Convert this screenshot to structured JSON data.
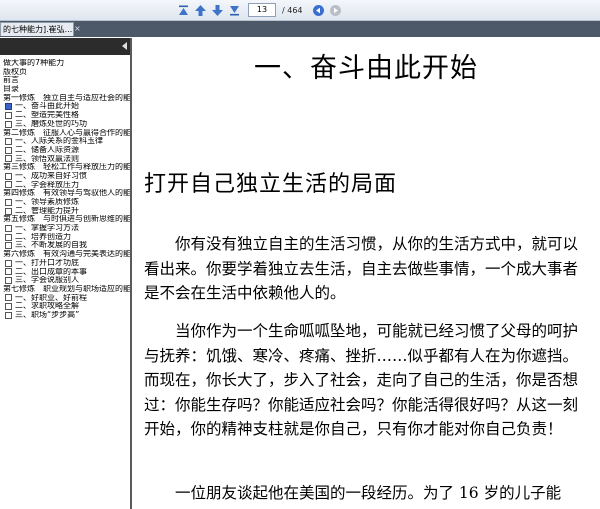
{
  "toolbar": {
    "page_current": "13",
    "page_total": "/ 464",
    "icons": [
      "first-page-icon",
      "previous-page-icon",
      "next-page-icon",
      "last-page-icon",
      "go-back-icon",
      "go-forward-icon"
    ]
  },
  "tab": {
    "title": "的七种能力].崔弘....",
    "close": "×"
  },
  "sidebar": {
    "items": [
      {
        "label": "做大事的7种能力",
        "box": false
      },
      {
        "label": "版权页",
        "box": false
      },
      {
        "label": "前言",
        "box": false
      },
      {
        "label": "目录",
        "box": false
      },
      {
        "label": "第一修炼　独立自主与适应社会的能",
        "box": false
      },
      {
        "label": "一、奋斗由此开始",
        "box": true,
        "selected": true
      },
      {
        "label": "二、塑造完美性格",
        "box": true
      },
      {
        "label": "三、磨炼处世的巧功",
        "box": true
      },
      {
        "label": "第二修炼　征服人心与赢得合作的能",
        "box": false
      },
      {
        "label": "一、人际关系的金科玉律",
        "box": true
      },
      {
        "label": "二、储备人际资源",
        "box": true
      },
      {
        "label": "三、领悟双赢法则",
        "box": true
      },
      {
        "label": "第三修炼　轻松工作与释放压力的能",
        "box": false
      },
      {
        "label": "一、成功来自好习惯",
        "box": true
      },
      {
        "label": "二、学会释放压力",
        "box": true
      },
      {
        "label": "第四修炼　有效领导与驾驭他人的能",
        "box": false
      },
      {
        "label": "一、领导素质修炼",
        "box": true
      },
      {
        "label": "二、管理能力提升",
        "box": true
      },
      {
        "label": "第五修炼　与时俱进与创新思维的能",
        "box": false
      },
      {
        "label": "一、掌握学习方法",
        "box": true
      },
      {
        "label": "二、培养创造力",
        "box": true
      },
      {
        "label": "三、不断发展的自我",
        "box": true
      },
      {
        "label": "第六修炼　有效沟通与完美表达的能",
        "box": false
      },
      {
        "label": "一、打开口才功底",
        "box": true
      },
      {
        "label": "二、出口成章的本事",
        "box": true
      },
      {
        "label": "三、学会说服别人",
        "box": true
      },
      {
        "label": "第七修炼　职业规划与职场适应的能",
        "box": false
      },
      {
        "label": "一、好职业、好前程",
        "box": true
      },
      {
        "label": "二、求职攻略全解",
        "box": true
      },
      {
        "label": "三、职场“步步高”",
        "box": true
      }
    ]
  },
  "document": {
    "chapter_title": "一、奋斗由此开始",
    "section_title": "打开自己独立生活的局面",
    "paragraphs": [
      "你有没有独立自主的生活习惯，从你的生活方式中，就可以看出来。你要学着独立去生活，自主去做些事情，一个成大事者是不会在生活中依赖他人的。",
      "当你作为一个生命呱呱坠地，可能就已经习惯了父母的呵护与抚养：饥饿、寒冷、疼痛、挫折……似乎都有人在为你遮挡。而现在，你长大了，步入了社会，走向了自己的生活，你是否想过：你能生存吗？你能适应社会吗？你能活得很好吗？从这一刻开始，你的精神支柱就是你自己，只有你才能对你自己负责！",
      "一位朋友谈起他在美国的一段经历。为了 16 岁的儿子能"
    ]
  }
}
